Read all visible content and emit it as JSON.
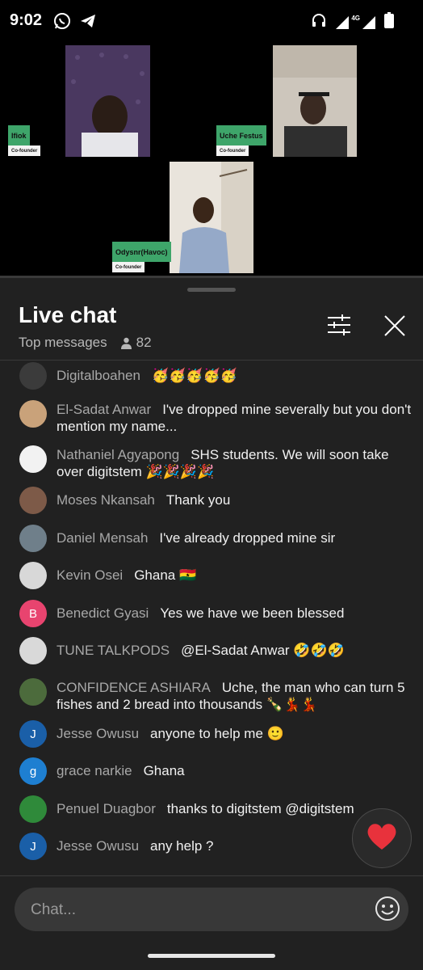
{
  "status": {
    "time": "9:02",
    "network": "4G"
  },
  "video": {
    "participants": [
      {
        "name": "Ifiok",
        "role": "Co-founder"
      },
      {
        "name": "Uche Festus",
        "role": "Co-founder"
      },
      {
        "name": "Odysnr(Havoc)",
        "role": "Co-founder"
      }
    ]
  },
  "chat": {
    "title": "Live chat",
    "filter_label": "Top messages",
    "viewer_count": "82",
    "input_placeholder": "Chat...",
    "messages": [
      {
        "author": "Digitalboahen",
        "text": "🥳🥳🥳🥳🥳",
        "avatar_letter": "",
        "avatar_color": "#3b3b3b"
      },
      {
        "author": "El-Sadat Anwar",
        "text": "I've dropped mine severally but you don't mention my name...",
        "avatar_letter": "",
        "avatar_color": "#c9a27a"
      },
      {
        "author": "Nathaniel Agyapong",
        "text": "SHS students. We will soon take over digitstem 🎉🎉🎉🎉",
        "avatar_letter": "",
        "avatar_color": "#f2f2f2"
      },
      {
        "author": "Moses Nkansah",
        "text": "Thank you",
        "avatar_letter": "",
        "avatar_color": "#7d5a48"
      },
      {
        "author": "Daniel Mensah",
        "text": "I've already dropped mine sir",
        "avatar_letter": "",
        "avatar_color": "#6f7f8a"
      },
      {
        "author": "Kevin Osei",
        "text": "Ghana 🇬🇭",
        "avatar_letter": "",
        "avatar_color": "#d8d8d8"
      },
      {
        "author": "Benedict Gyasi",
        "text": "Yes we have we been blessed",
        "avatar_letter": "B",
        "avatar_color": "#e8446f"
      },
      {
        "author": "TUNE TALKPODS",
        "text": "@El-Sadat Anwar 🤣🤣🤣",
        "avatar_letter": "",
        "avatar_color": "#d9d9d9"
      },
      {
        "author": "CONFIDENCE ASHIARA",
        "text": "Uche, the man who can turn 5 fishes and 2 bread into thousands 🍾💃💃",
        "avatar_letter": "",
        "avatar_color": "#4c6b3c"
      },
      {
        "author": "Jesse Owusu",
        "text": "anyone to help me 🙂",
        "avatar_letter": "J",
        "avatar_color": "#1a5fa8"
      },
      {
        "author": "grace narkie",
        "text": "Ghana",
        "avatar_letter": "g",
        "avatar_color": "#1e7fd1"
      },
      {
        "author": "Penuel Duagbor",
        "text": "thanks to digitstem @digitstem",
        "avatar_letter": "",
        "avatar_color": "#2f8a3a"
      },
      {
        "author": "Jesse Owusu",
        "text": "any help ?",
        "avatar_letter": "J",
        "avatar_color": "#1a5fa8"
      }
    ]
  },
  "icons": {
    "status_left": [
      "whatsapp-icon",
      "telegram-icon"
    ],
    "status_right": [
      "headphones-icon",
      "signal-icon",
      "battery-icon"
    ],
    "header": [
      "person-icon",
      "filter-icon",
      "close-icon"
    ],
    "input": [
      "emoji-icon"
    ],
    "fab": "heart-icon"
  },
  "colors": {
    "name_tag": "#3ea56a",
    "chat_bg": "#212121",
    "heart": "#e8323c"
  }
}
